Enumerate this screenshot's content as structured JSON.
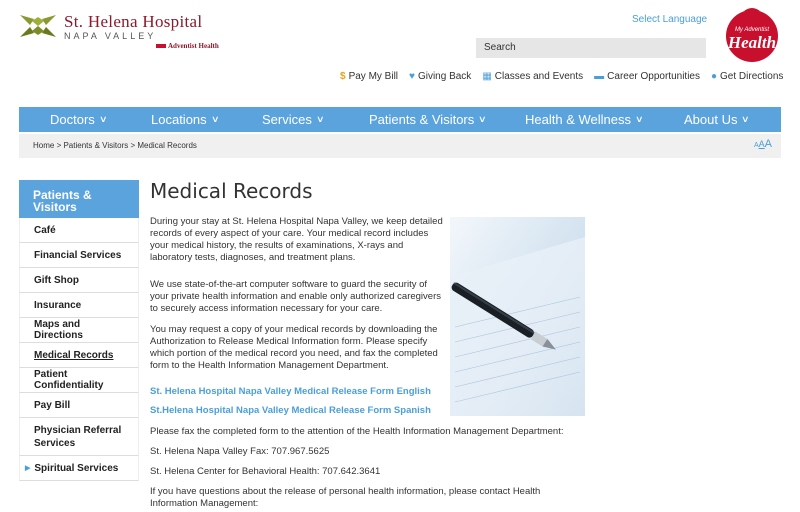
{
  "header": {
    "logo_line1": "St. Helena Hospital",
    "logo_line2": "NAPA VALLEY",
    "logo_affiliate": "Adventist Health",
    "select_language": "Select Language",
    "search_placeholder": "Search",
    "myhealth_line1": "My Adventist",
    "myhealth_line2": "Health"
  },
  "utility_links": [
    {
      "label": "Pay My Bill",
      "icon": "dollar-icon"
    },
    {
      "label": "Giving Back",
      "icon": "heart-icon"
    },
    {
      "label": "Classes and Events",
      "icon": "calendar-icon"
    },
    {
      "label": "Career Opportunities",
      "icon": "briefcase-icon"
    },
    {
      "label": "Get Directions",
      "icon": "location-pin-icon"
    }
  ],
  "nav": [
    {
      "label": "Doctors"
    },
    {
      "label": "Locations"
    },
    {
      "label": "Services"
    },
    {
      "label": "Patients & Visitors"
    },
    {
      "label": "Health & Wellness"
    },
    {
      "label": "About Us"
    }
  ],
  "breadcrumb": "Home > Patients & Visitors > Medical Records",
  "text_size": {
    "small": "A",
    "medium": "A",
    "large": "A"
  },
  "sidebar": {
    "heading": "Patients & Visitors",
    "items": [
      {
        "label": "Café"
      },
      {
        "label": "Financial Services"
      },
      {
        "label": "Gift Shop"
      },
      {
        "label": "Insurance"
      },
      {
        "label": "Maps and Directions"
      },
      {
        "label": "Medical Records"
      },
      {
        "label": "Patient Confidentiality"
      },
      {
        "label": "Pay Bill"
      },
      {
        "label": "Physician Referral Services"
      },
      {
        "label": "Spiritual Services"
      }
    ]
  },
  "content": {
    "title": "Medical Records",
    "p1": "During your stay at St. Helena Hospital Napa Valley, we keep detailed records of every aspect of your care. Your medical record includes your medical history, the results of examinations, X-rays and laboratory tests, diagnoses, and treatment plans.",
    "p2": "We use state-of-the-art computer software to guard the security of your private health information and enable only authorized caregivers to securely access information necessary for your care.",
    "p3": "You may request a copy of your medical records by downloading the Authorization to Release Medical Information form. Please specify which portion of the medical record you need, and fax the completed form to the Health Information Management Department.",
    "link1": "St. Helena Hospital Napa Valley Medical Release Form English",
    "link2": "St.Helena Hospital Napa Valley Medical Release Form Spanish",
    "p4": "Please fax the completed form to the attention of the Health Information Management Department:",
    "p5": "St. Helena Napa Valley Fax: 707.967.5625",
    "p6": "St. Helena Center for Behavioral Health: 707.642.3641",
    "p7": "If you have questions about the release of personal health information, please contact Health Information Management:"
  },
  "colors": {
    "brand_blue": "#5ba3dd",
    "brand_red": "#c8102e",
    "logo_green": "#8a9a2e"
  }
}
